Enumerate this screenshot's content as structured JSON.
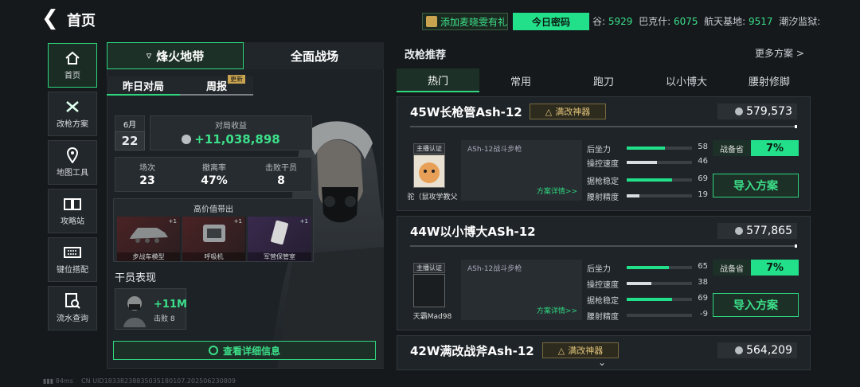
{
  "header": {
    "title": "首页",
    "promo": "添加麦晓雯有礼",
    "daily_code": "今日密码",
    "ledger": [
      {
        "label": "谷:",
        "value": "5929"
      },
      {
        "label": "巴克什:",
        "value": "6075"
      },
      {
        "label": "航天基地:",
        "value": "9517"
      },
      {
        "label": "潮汐监狱:",
        "value": ""
      }
    ]
  },
  "sidebar": {
    "items": [
      {
        "label": "首页",
        "icon": "home-icon"
      },
      {
        "label": "改枪方案",
        "icon": "tools-icon"
      },
      {
        "label": "地图工具",
        "icon": "map-pin-icon"
      },
      {
        "label": "攻略站",
        "icon": "book-icon"
      },
      {
        "label": "键位搭配",
        "icon": "keyboard-icon"
      },
      {
        "label": "流水查询",
        "icon": "search-doc-icon"
      }
    ]
  },
  "left": {
    "mode_tabs": [
      "烽火地带",
      "全面战场"
    ],
    "sub_tabs": [
      "昨日对局",
      "周报"
    ],
    "sub_badge": "更新",
    "month": "6月",
    "day": "22",
    "income_label": "对局收益",
    "income_value": "+11,038,898",
    "stats": [
      {
        "label": "场次",
        "value": "23"
      },
      {
        "label": "撤离率",
        "value": "47%"
      },
      {
        "label": "击败干员",
        "value": "8"
      }
    ],
    "loot_title": "高价值带出",
    "loot": [
      {
        "name": "步战车模型",
        "count": "+1"
      },
      {
        "name": "呼吸机",
        "count": "+1"
      },
      {
        "name": "军营保管室",
        "count": "+1"
      }
    ],
    "operator_title": "干员表现",
    "operator_gain": "+11M",
    "operator_kills": "击败 8",
    "detail_button": "查看详细信息"
  },
  "right": {
    "title": "改枪推荐",
    "more": "更多方案 >",
    "filter_tabs": [
      "热门",
      "常用",
      "跑刀",
      "以小博大",
      "腰射修脚"
    ],
    "cards": [
      {
        "title": "45W长枪管Ash-12",
        "tag": "满改神器",
        "price": "579,573",
        "streamer_label": "主播认证",
        "streamer_name": "驼（鼠攻学教父",
        "weapon": "ASh-12战斗步枪",
        "detail": "方案详情>>",
        "stats": [
          {
            "label": "后坐力",
            "value": "58",
            "fill": 0.58,
            "green": true
          },
          {
            "label": "操控速度",
            "value": "46",
            "fill": 0.46,
            "green": false
          },
          {
            "label": "据枪稳定",
            "value": "69",
            "fill": 0.69,
            "green": true
          },
          {
            "label": "腰射精度",
            "value": "19",
            "fill": 0.19,
            "green": false
          }
        ],
        "pct_label": "战备省",
        "pct": "7%",
        "import": "导入方案"
      },
      {
        "title": "44W以小博大ASh-12",
        "tag": "",
        "price": "577,865",
        "streamer_label": "主播认证",
        "streamer_name": "天霸Mad98",
        "weapon": "ASh-12战斗步枪",
        "detail": "方案详情>>",
        "stats": [
          {
            "label": "后坐力",
            "value": "65",
            "fill": 0.65,
            "green": true
          },
          {
            "label": "操控速度",
            "value": "38",
            "fill": 0.38,
            "green": false
          },
          {
            "label": "据枪稳定",
            "value": "69",
            "fill": 0.69,
            "green": true
          },
          {
            "label": "腰射精度",
            "value": "-9",
            "fill": 0.0,
            "green": false
          }
        ],
        "pct_label": "战备省",
        "pct": "7%",
        "import": "导入方案"
      },
      {
        "title": "42W满改战斧Ash-12",
        "tag": "满改神器",
        "price": "564,209"
      }
    ]
  },
  "footer": {
    "ping": "84ms",
    "uid": "CN UID18338238835035180107.202506230809"
  },
  "colors": {
    "accent": "#22e08a",
    "gold": "#c9a450",
    "panel": "#1f2428"
  }
}
